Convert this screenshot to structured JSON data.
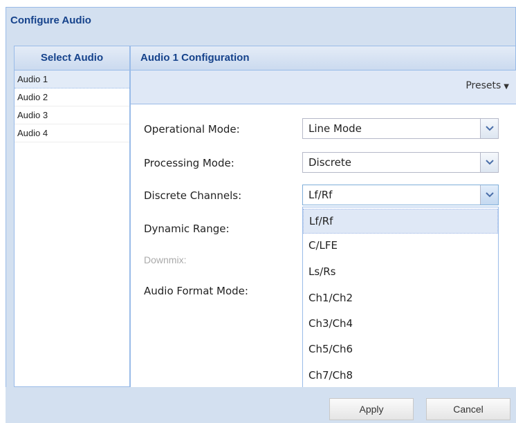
{
  "window": {
    "title": "Configure Audio"
  },
  "left_panel": {
    "header": "Select Audio",
    "items": [
      {
        "label": "Audio 1",
        "selected": true
      },
      {
        "label": "Audio 2"
      },
      {
        "label": "Audio 3"
      },
      {
        "label": "Audio 4"
      }
    ]
  },
  "right_panel": {
    "header": "Audio 1 Configuration",
    "presets_label": "Presets"
  },
  "form": {
    "operational_mode": {
      "label": "Operational Mode:",
      "value": "Line Mode"
    },
    "processing_mode": {
      "label": "Processing Mode:",
      "value": "Discrete"
    },
    "discrete_channels": {
      "label": "Discrete Channels:",
      "value": "Lf/Rf"
    },
    "dynamic_range": {
      "label": "Dynamic Range:"
    },
    "downmix": {
      "label": "Downmix:",
      "disabled": true
    },
    "audio_format_mode": {
      "label": "Audio Format Mode:"
    }
  },
  "dropdown": {
    "options": [
      "Lf/Rf",
      "C/LFE",
      "Ls/Rs",
      "Ch1/Ch2",
      "Ch3/Ch4",
      "Ch5/Ch6",
      "Ch7/Ch8"
    ],
    "highlighted": "Lf/Rf"
  },
  "buttons": {
    "apply": "Apply",
    "cancel": "Cancel"
  },
  "colors": {
    "header_text": "#15428b",
    "border": "#99bbe8",
    "panel_bg": "#d3e0f0"
  }
}
